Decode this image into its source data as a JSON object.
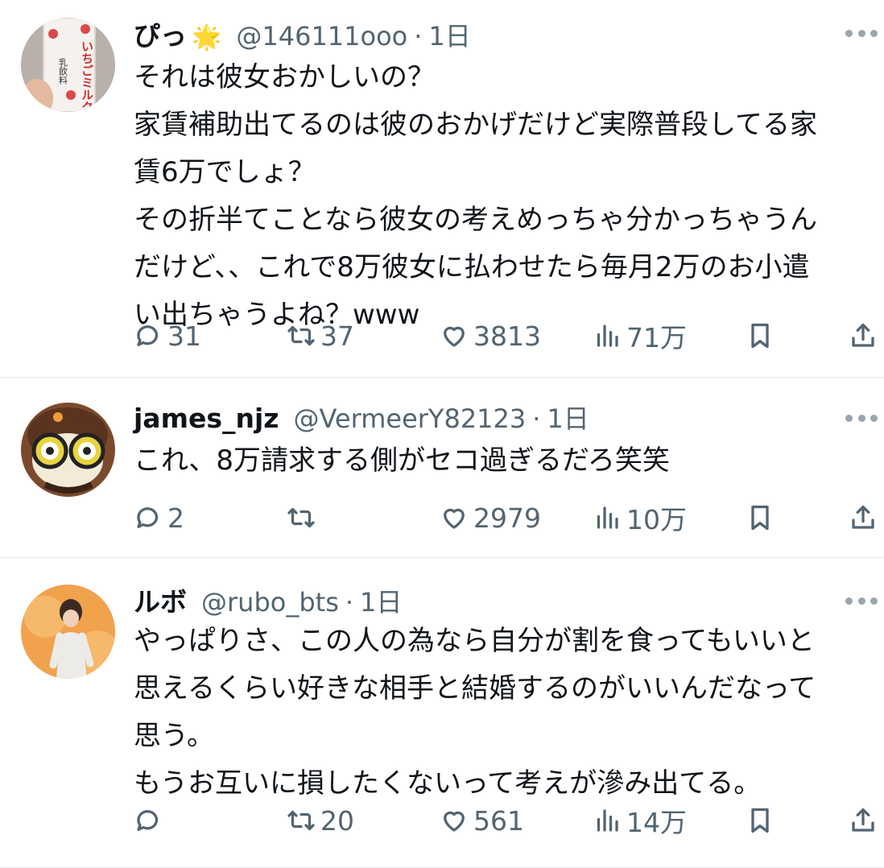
{
  "posts": [
    {
      "name": "ぴっ",
      "badge": "🌟",
      "handle": "@146111ooo",
      "sep": "·",
      "time": "1日",
      "lines": [
        "それは彼女おかしいの？",
        "家賃補助出てるのは彼のおかげだけど実際普段してる家",
        "賃6万でしょ？",
        "その折半てことなら彼女の考えめっちゃ分かっちゃうん",
        "だけど、、これで8万彼女に払わせたら毎月2万のお小遣",
        "い出ちゃうよね？www"
      ],
      "avatar_text": "いちごミルク",
      "avatar_sub": "乳飲料",
      "replies": "31",
      "reposts": "37",
      "likes": "3813",
      "views": "71万"
    },
    {
      "name": "james_njz",
      "handle": "@VermeerY82123",
      "sep": "·",
      "time": "1日",
      "lines": [
        "これ、8万請求する側がセコ過ぎるだろ笑笑"
      ],
      "replies": "2",
      "reposts": "",
      "likes": "2979",
      "views": "10万"
    },
    {
      "name": "ルボ",
      "handle": "@rubo_bts",
      "sep": "·",
      "time": "1日",
      "lines": [
        "やっぱりさ、この人の為なら自分が割を食ってもいいと",
        "思えるくらい好きな相手と結婚するのがいいんだなって",
        "思う。",
        "もうお互いに損したくないって考えが滲み出てる。"
      ],
      "replies": "",
      "reposts": "20",
      "likes": "561",
      "views": "14万"
    }
  ],
  "icons": {
    "reply": "reply-bubble-icon",
    "repost": "repost-arrows-icon",
    "like": "heart-icon",
    "views": "bar-chart-icon",
    "bookmark": "bookmark-icon",
    "share": "share-icon",
    "more": "more-dots-icon"
  },
  "colors": {
    "text": "#0f1419",
    "secondary": "#536471",
    "divider": "#e6e9ec",
    "badge": "#f2c335"
  }
}
